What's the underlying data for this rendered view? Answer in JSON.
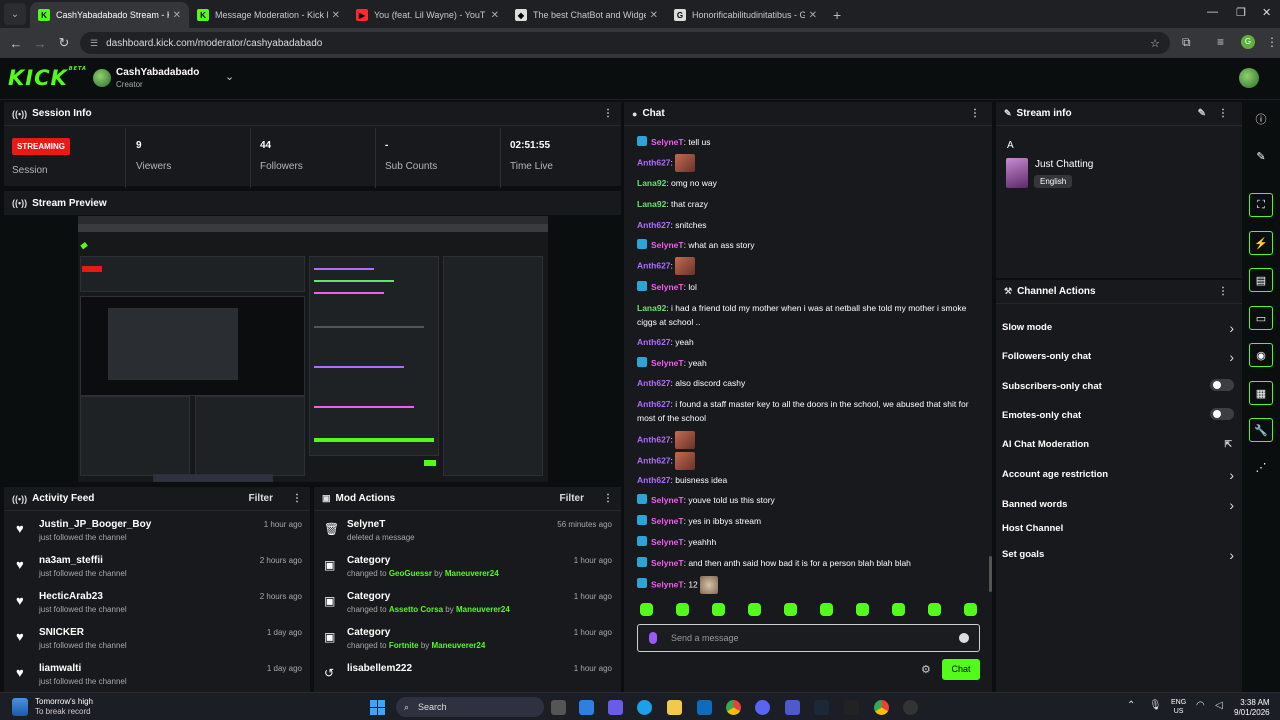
{
  "browser": {
    "tabs": [
      {
        "title": "CashYabadabado Stream - Kick",
        "favicon": "kick",
        "color": "#53fc18",
        "active": true
      },
      {
        "title": "Message Moderation - Kick Da",
        "favicon": "kick",
        "color": "#53fc18",
        "active": false
      },
      {
        "title": "You (feat. Lil Wayne) - YouT",
        "favicon": "youtube",
        "color": "#ff2a2a",
        "active": false
      },
      {
        "title": "The best ChatBot and Widgets",
        "favicon": "botrix",
        "color": "#dddddd",
        "active": false
      },
      {
        "title": "Honorificabilitudinitatibus - Go",
        "favicon": "google",
        "color": "#dddddd",
        "active": false
      }
    ],
    "url": "dashboard.kick.com/moderator/cashyabadabado",
    "profile_initial": "G"
  },
  "header": {
    "logo": "KICK",
    "logo_sup": "BETA",
    "channel_name": "CashYabadabado",
    "role": "Creator"
  },
  "session": {
    "title": "Session Info",
    "badge": "STREAMING",
    "stats": [
      {
        "value": "",
        "label": "Session"
      },
      {
        "value": "9",
        "label": "Viewers"
      },
      {
        "value": "44",
        "label": "Followers"
      },
      {
        "value": "-",
        "label": "Sub Counts"
      },
      {
        "value": "02:51:55",
        "label": "Time Live"
      }
    ]
  },
  "preview": {
    "title": "Stream Preview"
  },
  "activity": {
    "title": "Activity Feed",
    "filter": "Filter",
    "items": [
      {
        "name": "Justin_JP_Booger_Boy",
        "action": "just followed the channel",
        "time": "1 hour ago"
      },
      {
        "name": "na3am_steffii",
        "action": "just followed the channel",
        "time": "2 hours ago"
      },
      {
        "name": "HecticArab23",
        "action": "just followed the channel",
        "time": "2 hours ago"
      },
      {
        "name": "SNICKER",
        "action": "just followed the channel",
        "time": "1 day ago"
      },
      {
        "name": "liamwalti",
        "action": "just followed the channel",
        "time": "1 day ago"
      }
    ]
  },
  "mod_actions": {
    "title": "Mod Actions",
    "filter": "Filter",
    "items": [
      {
        "name": "SelyneT",
        "pre": "deleted a message",
        "val": "",
        "by": "",
        "user": "",
        "time": "56 minutes ago"
      },
      {
        "name": "Category",
        "pre": "changed to ",
        "val": "GeoGuessr",
        "by": " by ",
        "user": "Maneuverer24",
        "time": "1 hour ago"
      },
      {
        "name": "Category",
        "pre": "changed to ",
        "val": "Assetto Corsa",
        "by": " by ",
        "user": "Maneuverer24",
        "time": "1 hour ago"
      },
      {
        "name": "Category",
        "pre": "changed to ",
        "val": "Fortnite",
        "by": " by ",
        "user": "Maneuverer24",
        "time": "1 hour ago"
      },
      {
        "name": "lisabellem222",
        "pre": "",
        "val": "",
        "by": "",
        "user": "",
        "time": "1 hour ago"
      }
    ]
  },
  "chat": {
    "title": "Chat",
    "colors": {
      "SelyneT": "#f25ff0",
      "Anth627": "#b06cff",
      "Lana92": "#68e26f"
    },
    "messages": [
      {
        "user": "SelyneT",
        "badge": true,
        "text": ": tell us",
        "emote": ""
      },
      {
        "user": "Anth627",
        "badge": false,
        "text": ": ",
        "emote": "1"
      },
      {
        "user": "Lana92",
        "badge": false,
        "text": ": omg no way",
        "emote": ""
      },
      {
        "user": "Lana92",
        "badge": false,
        "text": ": that crazy",
        "emote": ""
      },
      {
        "user": "Anth627",
        "badge": false,
        "text": ": snitches",
        "emote": ""
      },
      {
        "user": "SelyneT",
        "badge": true,
        "text": ": what an ass story",
        "emote": ""
      },
      {
        "user": "Anth627",
        "badge": false,
        "text": ": ",
        "emote": "1"
      },
      {
        "user": "SelyneT",
        "badge": true,
        "text": ": lol",
        "emote": ""
      },
      {
        "user": "Lana92",
        "badge": false,
        "text": ": i had a friend told my mother when i was at netball she told my mother i smoke ciggs at school ..",
        "emote": ""
      },
      {
        "user": "Anth627",
        "badge": false,
        "text": ": yeah",
        "emote": ""
      },
      {
        "user": "SelyneT",
        "badge": true,
        "text": ": yeah",
        "emote": ""
      },
      {
        "user": "Anth627",
        "badge": false,
        "text": ": also discord cashy",
        "emote": ""
      },
      {
        "user": "Anth627",
        "badge": false,
        "text": ": i found a staff master key to all the doors in the school, we abused that shit for most of the school",
        "emote": ""
      },
      {
        "user": "Anth627",
        "badge": false,
        "text": ": ",
        "emote": "1"
      },
      {
        "user": "Anth627",
        "badge": false,
        "text": ": ",
        "emote": "1"
      },
      {
        "user": "Anth627",
        "badge": false,
        "text": ": buisness idea",
        "emote": ""
      },
      {
        "user": "SelyneT",
        "badge": true,
        "text": ": youve told us this story",
        "emote": ""
      },
      {
        "user": "SelyneT",
        "badge": true,
        "text": ": yes in ibbys stream",
        "emote": ""
      },
      {
        "user": "SelyneT",
        "badge": true,
        "text": ": yeahhh",
        "emote": ""
      },
      {
        "user": "SelyneT",
        "badge": true,
        "text": ": and then anth said how bad it is for a person blah blah blah",
        "emote": ""
      },
      {
        "user": "SelyneT",
        "badge": true,
        "text": ": 12 ",
        "emote": "2"
      }
    ],
    "placeholder": "Send a message",
    "send_label": "Chat"
  },
  "stream_info": {
    "title": "Stream info",
    "stream_title": "A",
    "category": "Just Chatting",
    "language": "English"
  },
  "channel_actions": {
    "title": "Channel Actions",
    "items": [
      {
        "label": "Slow mode",
        "control": "arrow"
      },
      {
        "label": "Followers-only chat",
        "control": "arrow"
      },
      {
        "label": "Subscribers-only chat",
        "control": "toggle"
      },
      {
        "label": "Emotes-only chat",
        "control": "toggle"
      },
      {
        "label": "AI Chat Moderation",
        "control": "external"
      },
      {
        "label": "Account age restriction",
        "control": "arrow"
      },
      {
        "label": "Banned words",
        "control": "arrow"
      },
      {
        "label": "Host Channel",
        "control": "none"
      },
      {
        "label": "Set goals",
        "control": "arrow"
      }
    ]
  },
  "taskbar": {
    "weather_title": "Tomorrow's high",
    "weather_sub": "To break record",
    "search": "Search",
    "lang_top": "ENG",
    "lang_bottom": "US",
    "time": "3:38 AM",
    "date": "9/01/2026"
  }
}
